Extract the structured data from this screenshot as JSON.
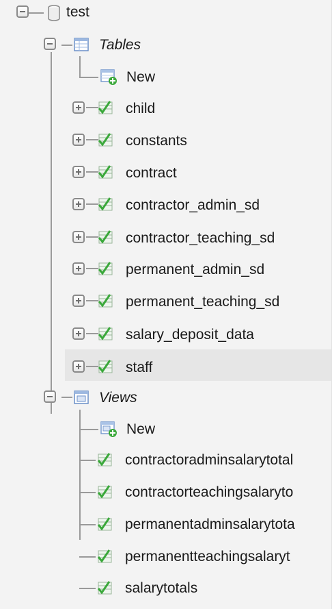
{
  "db": {
    "name": "test"
  },
  "tables": {
    "label": "Tables",
    "new_label": "New",
    "items": [
      "child",
      "constants",
      "contract",
      "contractor_admin_sd",
      "contractor_teaching_sd",
      "permanent_admin_sd",
      "permanent_teaching_sd",
      "salary_deposit_data",
      "staff"
    ]
  },
  "views": {
    "label": "Views",
    "new_label": "New",
    "items": [
      "contractoradminsalarytotal",
      "contractorteachingsalaryto",
      "permanentadminsalarytota",
      "permanentteachingsalaryt",
      "salarytotals"
    ]
  },
  "colors": {
    "tree_line": "#9a9a9a",
    "selected_row_bg": "#e6e6e6",
    "table_icon_green": "#3aa83a"
  }
}
